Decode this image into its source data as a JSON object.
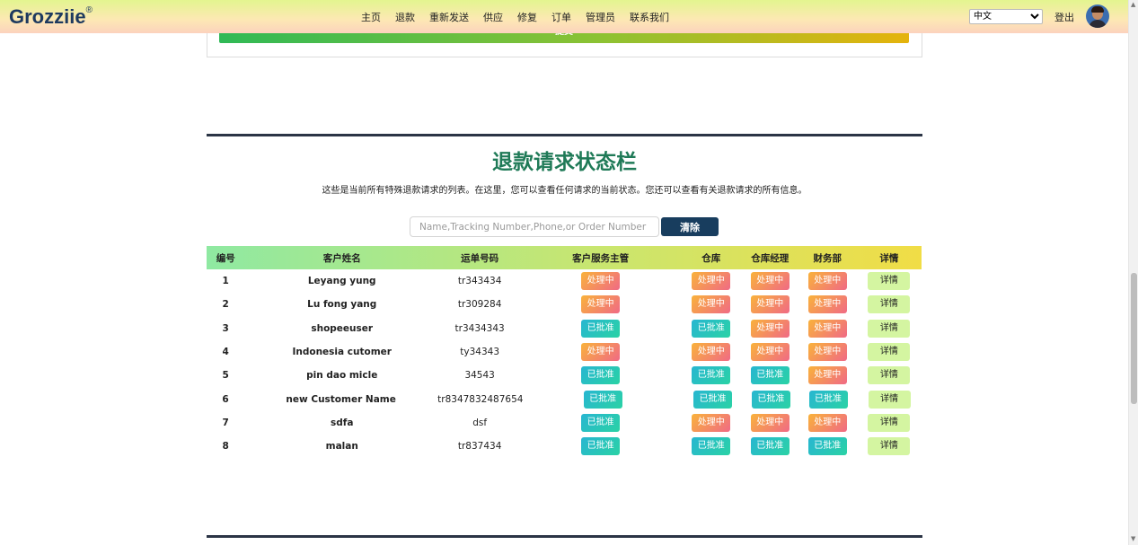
{
  "navbar": {
    "logo": "Grozziie",
    "logo_mark": "®",
    "links": [
      "主页",
      "退款",
      "重新发送",
      "供应",
      "修复",
      "订单",
      "管理员",
      "联系我们"
    ],
    "language": "中文",
    "logout": "登出"
  },
  "form": {
    "submit_label": "提交"
  },
  "section": {
    "title": "退款请求状态栏",
    "description": "这些是当前所有特殊退款请求的列表。在这里，您可以查看任何请求的当前状态。您还可以查看有关退款请求的所有信息。"
  },
  "search": {
    "placeholder": "Name,Tracking Number,Phone,or Order Number",
    "clear_label": "清除"
  },
  "table": {
    "headers": [
      "编号",
      "客户姓名",
      "运单号码",
      "客户服务主管",
      "仓库",
      "仓库经理",
      "财务部",
      "详情"
    ],
    "rows": [
      {
        "no": "1",
        "name": "Leyang yung",
        "tracking": "tr343434",
        "cs": "处理中",
        "wh": "处理中",
        "whm": "处理中",
        "fin": "处理中",
        "detail": "详情"
      },
      {
        "no": "2",
        "name": "Lu fong yang",
        "tracking": "tr309284",
        "cs": "处理中",
        "wh": "处理中",
        "whm": "处理中",
        "fin": "处理中",
        "detail": "详情"
      },
      {
        "no": "3",
        "name": "shopeeuser",
        "tracking": "tr3434343",
        "cs": "已批准",
        "wh": "已批准",
        "whm": "处理中",
        "fin": "处理中",
        "detail": "详情"
      },
      {
        "no": "4",
        "name": "Indonesia cutomer",
        "tracking": "ty34343",
        "cs": "处理中",
        "wh": "处理中",
        "whm": "处理中",
        "fin": "处理中",
        "detail": "详情"
      },
      {
        "no": "5",
        "name": "pin dao micle",
        "tracking": "34543",
        "cs": "已批准",
        "wh": "已批准",
        "whm": "已批准",
        "fin": "处理中",
        "detail": "详情"
      },
      {
        "no": "6",
        "name": "new Customer Name",
        "tracking": "tr8347832487654",
        "cs": "已批准",
        "wh": "已批准",
        "whm": "已批准",
        "fin": "已批准",
        "detail": "详情"
      },
      {
        "no": "7",
        "name": "sdfa",
        "tracking": "dsf",
        "cs": "已批准",
        "wh": "处理中",
        "whm": "处理中",
        "fin": "处理中",
        "detail": "详情"
      },
      {
        "no": "8",
        "name": "malan",
        "tracking": "tr837434",
        "cs": "已批准",
        "wh": "已批准",
        "whm": "已批准",
        "fin": "已批准",
        "detail": "详情"
      }
    ]
  },
  "colors": {
    "title": "#1f7a57",
    "processing": "#f06a85",
    "approved": "#28b6d1",
    "clear_button": "#183d5e"
  }
}
